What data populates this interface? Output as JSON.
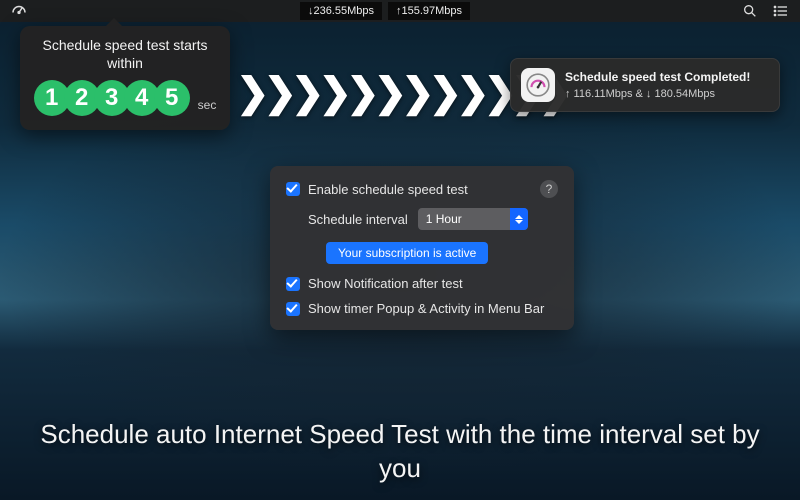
{
  "menubar": {
    "download_speed": "↓236.55Mbps",
    "upload_speed": "↑155.97Mbps"
  },
  "countdown": {
    "title": "Schedule speed test starts within",
    "digits": [
      "1",
      "2",
      "3",
      "4",
      "5"
    ],
    "unit": "sec"
  },
  "notification": {
    "title": "Schedule speed test Completed!",
    "subtitle": "↑ 116.11Mbps & ↓ 180.54Mbps"
  },
  "panel": {
    "enable_label": "Enable schedule speed test",
    "interval_label": "Schedule interval",
    "interval_value": "1 Hour",
    "subscription_label": "Your subscription is active",
    "show_notification_label": "Show Notification after test",
    "show_timer_label": "Show timer Popup & Activity in Menu Bar",
    "help": "?"
  },
  "tagline": "Schedule auto Internet Speed Test with the time interval set by you"
}
